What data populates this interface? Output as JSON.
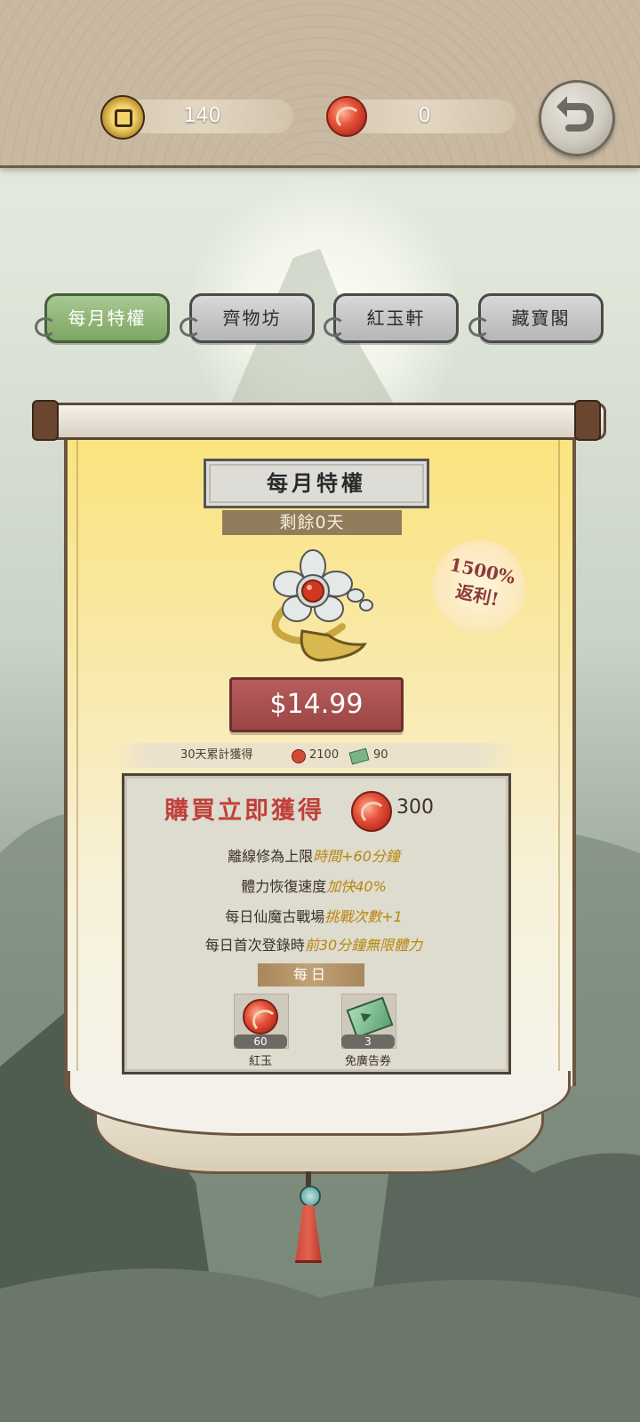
{
  "currencies": {
    "coins": {
      "value": "140",
      "icon": "coin-icon"
    },
    "red_jade": {
      "value": "0",
      "icon": "red-jade-icon"
    }
  },
  "tabs": [
    {
      "label": "每月特權",
      "active": true
    },
    {
      "label": "齊物坊",
      "active": false
    },
    {
      "label": "紅玉軒",
      "active": false
    },
    {
      "label": "藏寶閣",
      "active": false
    }
  ],
  "panel": {
    "title": "每月特權",
    "remaining": "剩餘0天",
    "rebate_line1": "1500%",
    "rebate_line2": "返利!",
    "price": "$14.99",
    "accumulated": {
      "label": "30天累計獲得",
      "jade_value": "2100",
      "ticket_value": "90"
    },
    "instant": {
      "title": "購買立即獲得",
      "amount": "300"
    },
    "perks": [
      {
        "text": "離線修為上限",
        "highlight": "時間+60分鐘"
      },
      {
        "text": "體力恢復速度",
        "highlight": "加快40%"
      },
      {
        "text": "每日仙魔古戰場",
        "highlight": "挑戰次數+1"
      },
      {
        "text": "每日首次登錄時",
        "highlight": "前30分鐘無限體力"
      }
    ],
    "daily_label": "每日",
    "daily_rewards": [
      {
        "count": "60",
        "name": "紅玉",
        "icon": "red-jade-icon"
      },
      {
        "count": "3",
        "name": "免廣告券",
        "icon": "ad-free-ticket-icon"
      }
    ]
  },
  "colors": {
    "active_tab": "#7da664",
    "price_button": "#9b4545",
    "buy_title": "#c0413a",
    "highlight": "#b8860b"
  }
}
